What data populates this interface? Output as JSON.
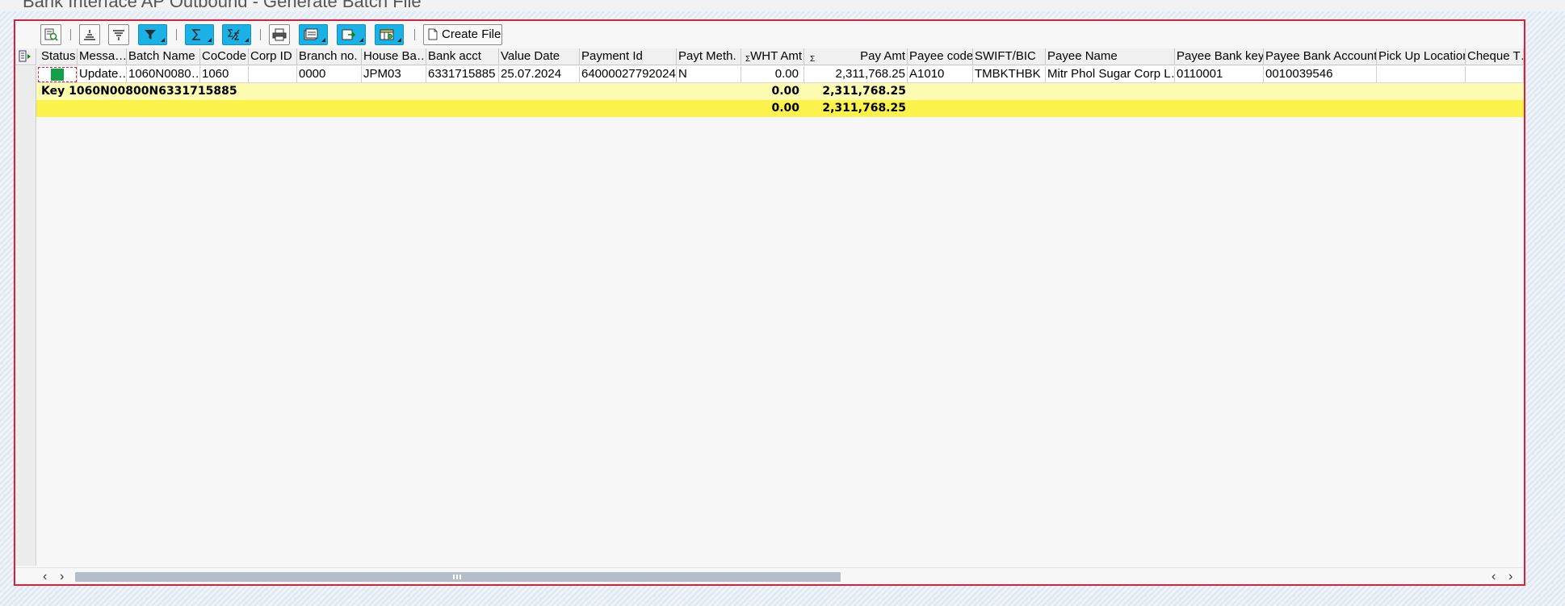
{
  "window": {
    "title": "Bank Interface AP Outbound - Generate Batch File"
  },
  "toolbar": {
    "create_file_label": "Create File",
    "icons": [
      "details-icon",
      "sort-ascending-icon",
      "sort-descending-icon",
      "filter-icon",
      "sum-icon",
      "subtotal-icon",
      "print-icon",
      "views-icon",
      "export-icon",
      "layout-icon",
      "document-icon"
    ]
  },
  "table": {
    "columns": [
      "Status",
      "Messa…",
      "Batch Name",
      "CoCode",
      "Corp ID",
      "Branch no.",
      "House Ba…",
      "Bank acct",
      "Value Date",
      "Payment Id",
      "Payt Meth.",
      "WHT Amt",
      "Pay Amt",
      "Payee code",
      "SWIFT/BIC",
      "Payee Name",
      "Payee Bank key",
      "Payee Bank Account",
      "Pick Up Location",
      "Cheque T…"
    ],
    "sum_markers": {
      "wht": "Σ",
      "pay": "Σ"
    },
    "rows": [
      {
        "status": "",
        "message": "Update…",
        "batch_name": "1060N0080…",
        "cocode": "1060",
        "corp_id": "",
        "branch_no": "0000",
        "house_bank": "JPM03",
        "bank_acct": "6331715885",
        "value_date": "25.07.2024",
        "payment_id": "64000027792024",
        "payt_meth": "N",
        "wht_amt": "0.00",
        "pay_amt": "2,311,768.25",
        "payee_code": "A1010",
        "swift_bic": "TMBKTHBK",
        "payee_name": "Mitr Phol Sugar Corp L…",
        "payee_bank_key": "0110001",
        "payee_bank_account": "0010039546",
        "pickup_location": "",
        "cheque": ""
      }
    ],
    "subtotal": {
      "label": "Key 1060N00800N6331715885",
      "wht_amt": "0.00",
      "pay_amt": "2,311,768.25"
    },
    "total": {
      "wht_amt": "0.00",
      "pay_amt": "2,311,768.25"
    },
    "status_colors": {
      "ok": "#12a04a"
    },
    "subtotal_color": "#fdfbb0",
    "total_color": "#fbf24c"
  },
  "scrollbar": {
    "left_arrow": "‹",
    "right_arrow": "›"
  }
}
